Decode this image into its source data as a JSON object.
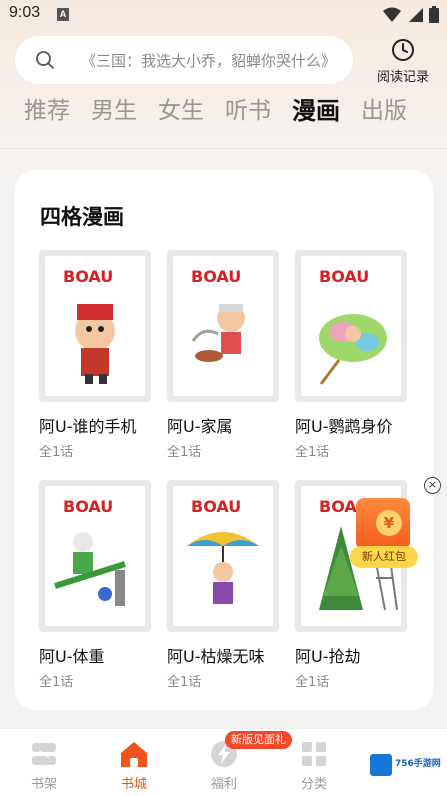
{
  "status": {
    "time": "9:03",
    "app_icon": "A"
  },
  "search": {
    "placeholder": "《三国：我选大小乔，貂蝉你哭什么》"
  },
  "history": {
    "label": "阅读记录"
  },
  "tabs": [
    {
      "label": "推荐",
      "active": false
    },
    {
      "label": "男生",
      "active": false
    },
    {
      "label": "女生",
      "active": false
    },
    {
      "label": "听书",
      "active": false
    },
    {
      "label": "漫画",
      "active": true
    },
    {
      "label": "出版",
      "active": false
    }
  ],
  "section": {
    "title": "四格漫画"
  },
  "books": [
    {
      "title": "阿U-谁的手机",
      "sub": "全1话",
      "cover_logo": "BOAU"
    },
    {
      "title": "阿U-家属",
      "sub": "全1话",
      "cover_logo": "BOAU"
    },
    {
      "title": "阿U-鹦鹉身价",
      "sub": "全1话",
      "cover_logo": "BOAU"
    },
    {
      "title": "阿U-体重",
      "sub": "全1话",
      "cover_logo": "BOAU"
    },
    {
      "title": "阿U-枯燥无味",
      "sub": "全1话",
      "cover_logo": "BOAU"
    },
    {
      "title": "阿U-抢劫",
      "sub": "全1话",
      "cover_logo": "BOAU"
    }
  ],
  "red_packet": {
    "coin": "¥",
    "label": "新人红包",
    "close": "×"
  },
  "nav": {
    "items": [
      {
        "label": "书架",
        "active": false
      },
      {
        "label": "书城",
        "active": true
      },
      {
        "label": "福利",
        "active": false
      },
      {
        "label": "分类",
        "active": false
      }
    ],
    "badge": "新版见面礼"
  },
  "watermark": {
    "text": "756手游网"
  },
  "colors": {
    "accent": "#f2531e",
    "badge": "#f04a2a",
    "packet": "#ff7a2e"
  }
}
